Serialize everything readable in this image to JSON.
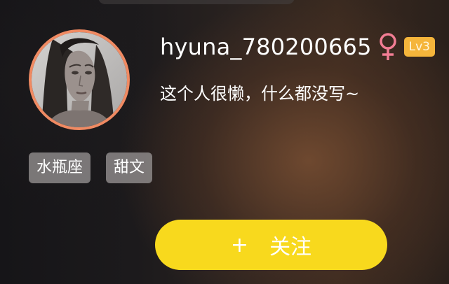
{
  "profile": {
    "username": "hyuna_780200665",
    "gender_icon": "female-symbol-icon",
    "level": "Lv3",
    "bio": "这个人很懒，什么都没写~",
    "avatar_border_color": "#f08a62"
  },
  "tags": [
    "水瓶座",
    "甜文"
  ],
  "follow_button": {
    "icon": "+",
    "label": "关注",
    "color": "#f8d91d"
  },
  "colors": {
    "level_badge": "#f5b53b",
    "gender_icon": "#f27d94"
  }
}
